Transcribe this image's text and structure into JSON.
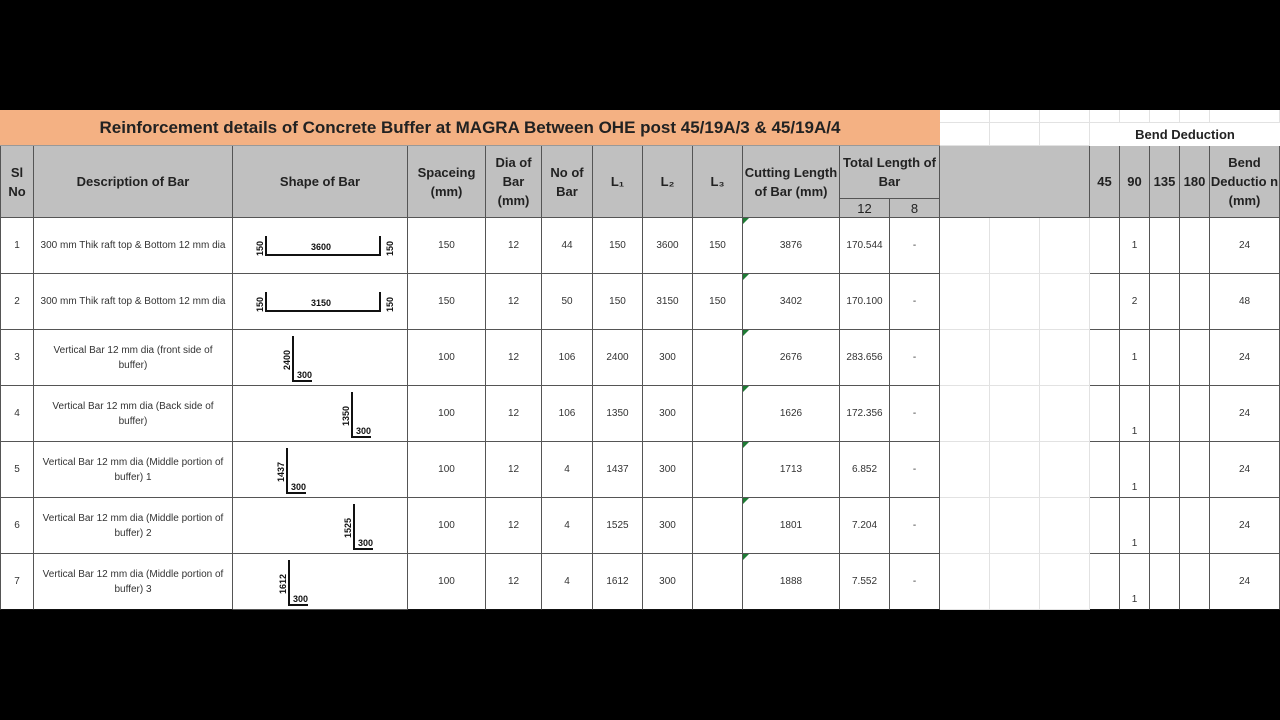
{
  "title": "Reinforcement details of Concrete Buffer at MAGRA Between OHE post 45/19A/3 & 45/19A/4",
  "headers": {
    "sl_no": "Sl No",
    "description": "Description of Bar",
    "shape": "Shape of Bar",
    "spacing": "Spaceing (mm)",
    "dia": "Dia of Bar (mm)",
    "no_of_bar": "No of Bar",
    "l1": "L₁",
    "l2": "L₂",
    "l3": "L₃",
    "cutting_length": "Cutting Length of Bar (mm)",
    "total_length": "Total Length of Bar",
    "total_12": "12",
    "total_8": "8"
  },
  "bend": {
    "title": "Bend Deduction",
    "h45": "45",
    "h90": "90",
    "h135": "135",
    "h180": "180",
    "hdeduction": "Bend Deductio n (mm)"
  },
  "rows": [
    {
      "sl": "1",
      "desc": "300 mm Thik raft top & Bottom 12 mm dia",
      "shape": {
        "type": "U",
        "left": "150",
        "mid": "3600",
        "right": "150"
      },
      "spacing": "150",
      "dia": "12",
      "no": "44",
      "l1": "150",
      "l2": "3600",
      "l3": "150",
      "cut": "3876",
      "t12": "170.544",
      "t8": "-",
      "b45": "",
      "b90": "1",
      "b135": "",
      "b180": "",
      "bd": "24"
    },
    {
      "sl": "2",
      "desc": "300 mm Thik raft top & Bottom 12 mm dia",
      "shape": {
        "type": "U",
        "left": "150",
        "mid": "3150",
        "right": "150"
      },
      "spacing": "150",
      "dia": "12",
      "no": "50",
      "l1": "150",
      "l2": "3150",
      "l3": "150",
      "cut": "3402",
      "t12": "170.100",
      "t8": "-",
      "b45": "",
      "b90": "2",
      "b135": "",
      "b180": "",
      "bd": "48"
    },
    {
      "sl": "3",
      "desc": "Vertical Bar 12 mm dia (front side of buffer)",
      "shape": {
        "type": "L",
        "vert": "2400",
        "horiz": "300"
      },
      "spacing": "100",
      "dia": "12",
      "no": "106",
      "l1": "2400",
      "l2": "300",
      "l3": "",
      "cut": "2676",
      "t12": "283.656",
      "t8": "-",
      "b45": "",
      "b90": "1",
      "b135": "",
      "b180": "",
      "bd": "24"
    },
    {
      "sl": "4",
      "desc": "Vertical Bar 12 mm dia (Back side of buffer)",
      "shape": {
        "type": "L",
        "vert": "1350",
        "horiz": "300"
      },
      "spacing": "100",
      "dia": "12",
      "no": "106",
      "l1": "1350",
      "l2": "300",
      "l3": "",
      "cut": "1626",
      "t12": "172.356",
      "t8": "-",
      "b45": "",
      "b90": "1",
      "b135": "",
      "b180": "",
      "bd": "24"
    },
    {
      "sl": "5",
      "desc": "Vertical Bar 12 mm dia (Middle portion of buffer) 1",
      "shape": {
        "type": "L",
        "vert": "1437",
        "horiz": "300"
      },
      "spacing": "100",
      "dia": "12",
      "no": "4",
      "l1": "1437",
      "l2": "300",
      "l3": "",
      "cut": "1713",
      "t12": "6.852",
      "t8": "-",
      "b45": "",
      "b90": "1",
      "b135": "",
      "b180": "",
      "bd": "24"
    },
    {
      "sl": "6",
      "desc": "Vertical Bar 12 mm dia (Middle portion of buffer) 2",
      "shape": {
        "type": "L",
        "vert": "1525",
        "horiz": "300"
      },
      "spacing": "100",
      "dia": "12",
      "no": "4",
      "l1": "1525",
      "l2": "300",
      "l3": "",
      "cut": "1801",
      "t12": "7.204",
      "t8": "-",
      "b45": "",
      "b90": "1",
      "b135": "",
      "b180": "",
      "bd": "24"
    },
    {
      "sl": "7",
      "desc": "Vertical Bar 12 mm dia (Middle portion of buffer) 3",
      "shape": {
        "type": "L",
        "vert": "1612",
        "horiz": "300"
      },
      "spacing": "100",
      "dia": "12",
      "no": "4",
      "l1": "1612",
      "l2": "300",
      "l3": "",
      "cut": "1888",
      "t12": "7.552",
      "t8": "-",
      "b45": "",
      "b90": "1",
      "b135": "",
      "b180": "",
      "bd": "24"
    }
  ],
  "colors": {
    "title_bg": "#f4b183",
    "header_bg": "#c0c0c0",
    "comment_marker": "#1e7b34"
  }
}
